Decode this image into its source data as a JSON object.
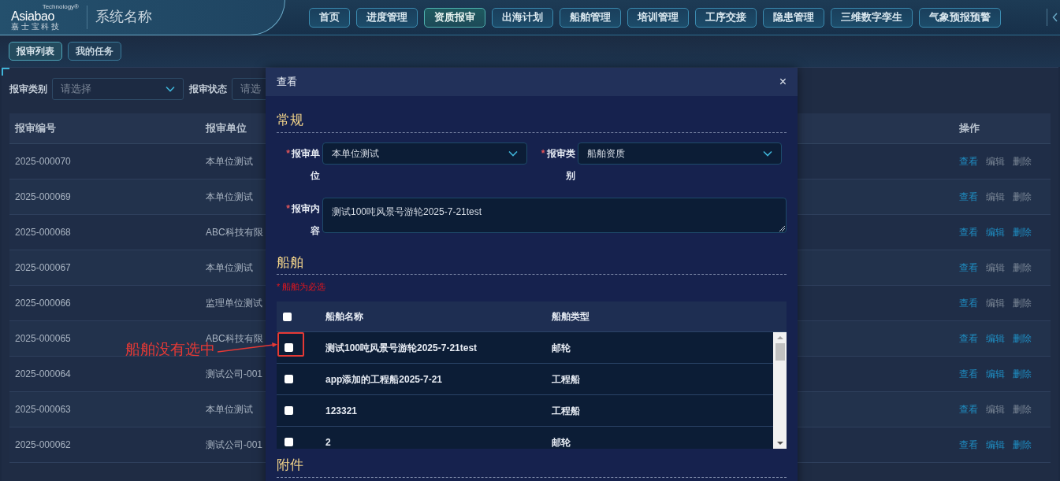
{
  "header": {
    "logo": {
      "brand": "Asiabao",
      "tagline": "Technology®",
      "subtitle": "嘉 士 宝 科 技"
    },
    "system_name": "系统名称",
    "nav": [
      {
        "label": "首页",
        "selected": false
      },
      {
        "label": "进度管理",
        "selected": false
      },
      {
        "label": "资质报审",
        "selected": true
      },
      {
        "label": "出海计划",
        "selected": false
      },
      {
        "label": "船舶管理",
        "selected": false
      },
      {
        "label": "培训管理",
        "selected": false
      },
      {
        "label": "工序交接",
        "selected": false
      },
      {
        "label": "隐患管理",
        "selected": false
      },
      {
        "label": "三维数字孪生",
        "selected": false
      },
      {
        "label": "气象预报预警",
        "selected": false
      }
    ]
  },
  "subnav": [
    {
      "label": "报审列表",
      "selected": true
    },
    {
      "label": "我的任务",
      "selected": false
    }
  ],
  "filters": [
    {
      "label": "报审类别",
      "placeholder": "请选择"
    },
    {
      "label": "报审状态",
      "placeholder": "请选"
    }
  ],
  "table": {
    "columns": [
      "报审编号",
      "报审单位",
      "操作"
    ],
    "rows": [
      {
        "number": "2025-000070",
        "unit": "本单位测试",
        "actions": [
          {
            "label": "查看",
            "enabled": true
          },
          {
            "label": "编辑",
            "enabled": false
          },
          {
            "label": "删除",
            "enabled": false
          }
        ]
      },
      {
        "number": "2025-000069",
        "unit": "本单位测试",
        "actions": [
          {
            "label": "查看",
            "enabled": true
          },
          {
            "label": "编辑",
            "enabled": false
          },
          {
            "label": "删除",
            "enabled": false
          }
        ]
      },
      {
        "number": "2025-000068",
        "unit": "ABC科技有限",
        "actions": [
          {
            "label": "查看",
            "enabled": true
          },
          {
            "label": "编辑",
            "enabled": true
          },
          {
            "label": "删除",
            "enabled": true
          }
        ]
      },
      {
        "number": "2025-000067",
        "unit": "本单位测试",
        "actions": [
          {
            "label": "查看",
            "enabled": true
          },
          {
            "label": "编辑",
            "enabled": false
          },
          {
            "label": "删除",
            "enabled": false
          }
        ]
      },
      {
        "number": "2025-000066",
        "unit": "监理单位测试",
        "actions": [
          {
            "label": "查看",
            "enabled": true
          },
          {
            "label": "编辑",
            "enabled": false
          },
          {
            "label": "删除",
            "enabled": false
          }
        ]
      },
      {
        "number": "2025-000065",
        "unit": "ABC科技有限",
        "actions": [
          {
            "label": "查看",
            "enabled": true
          },
          {
            "label": "编辑",
            "enabled": true
          },
          {
            "label": "删除",
            "enabled": true
          }
        ]
      },
      {
        "number": "2025-000064",
        "unit": "测试公司-001",
        "actions": [
          {
            "label": "查看",
            "enabled": true
          },
          {
            "label": "编辑",
            "enabled": true
          },
          {
            "label": "删除",
            "enabled": true
          }
        ]
      },
      {
        "number": "2025-000063",
        "unit": "本单位测试",
        "actions": [
          {
            "label": "查看",
            "enabled": true
          },
          {
            "label": "编辑",
            "enabled": false
          },
          {
            "label": "删除",
            "enabled": false
          }
        ]
      },
      {
        "number": "2025-000062",
        "unit": "测试公司-001",
        "actions": [
          {
            "label": "查看",
            "enabled": true
          },
          {
            "label": "编辑",
            "enabled": true
          },
          {
            "label": "删除",
            "enabled": true
          }
        ]
      }
    ]
  },
  "dialog": {
    "title": "查看",
    "close": "×",
    "general": {
      "title": "常规",
      "fields": [
        {
          "required_mark": "*",
          "label": "报审单位",
          "value": "本单位测试",
          "kind": "select"
        },
        {
          "required_mark": "*",
          "label": "报审类别",
          "value": "船舶资质",
          "kind": "select"
        },
        {
          "required_mark": "*",
          "label": "报审内容",
          "value": "测试100吨风景号游轮2025-7-21test",
          "kind": "textarea"
        }
      ]
    },
    "vessels": {
      "title": "船舶",
      "hint": "* 船舶为必选",
      "all_checked": false,
      "columns": [
        "船舶名称",
        "船舶类型"
      ],
      "rows": [
        {
          "name": "测试100吨风景号游轮2025-7-21test",
          "type": "邮轮",
          "checked": false
        },
        {
          "name": "app添加的工程船2025-7-21",
          "type": "工程船",
          "checked": false
        },
        {
          "name": "123321",
          "type": "工程船",
          "checked": false
        },
        {
          "name": "2",
          "type": "邮轮",
          "checked": false
        }
      ]
    },
    "attachments": {
      "title": "附件"
    }
  },
  "annotation": {
    "text": "船舶没有选中"
  }
}
